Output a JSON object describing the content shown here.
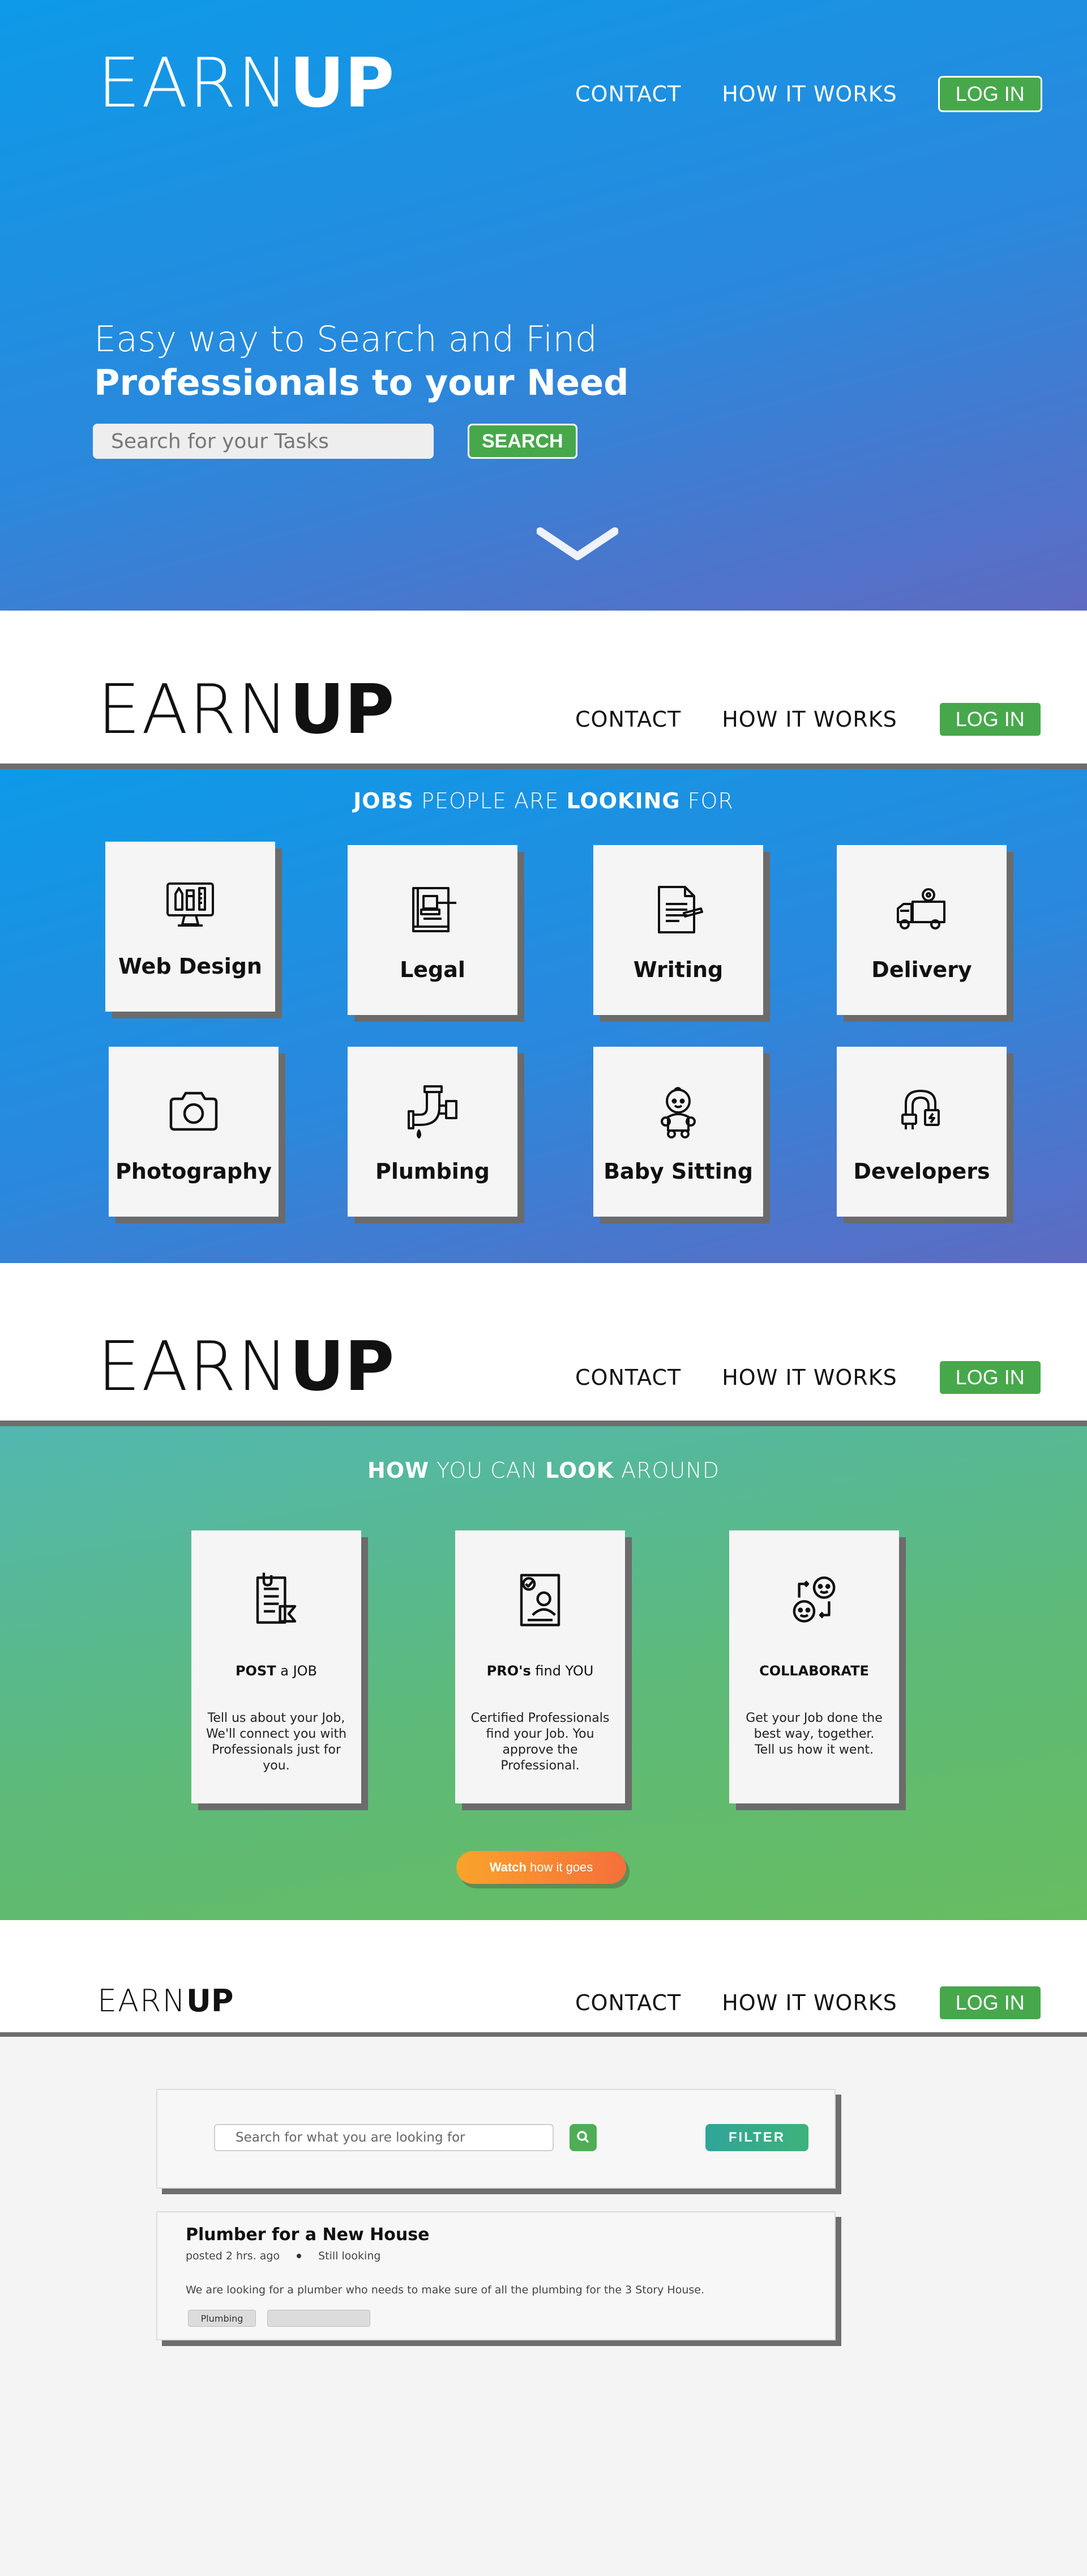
{
  "brand": {
    "light": "EARN",
    "bold": "UP"
  },
  "nav": {
    "contact": "CONTACT",
    "how_it_works": "HOW IT WORKS",
    "login": "LOG IN"
  },
  "hero": {
    "line1": "Easy way to Search and Find",
    "line2": "Professionals to your Need",
    "search_placeholder": "Search for your Tasks",
    "search_button": "SEARCH"
  },
  "jobs": {
    "heading": {
      "b1": "JOBS",
      "t1": " PEOPLE ARE ",
      "b2": "LOOKING",
      "t2": " FOR"
    },
    "items": [
      {
        "label": "Web Design",
        "icon": "monitor-tools-icon"
      },
      {
        "label": "Legal",
        "icon": "law-book-gavel-icon"
      },
      {
        "label": "Writing",
        "icon": "document-pen-icon"
      },
      {
        "label": "Delivery",
        "icon": "delivery-truck-icon"
      },
      {
        "label": "Photography",
        "icon": "camera-icon"
      },
      {
        "label": "Plumbing",
        "icon": "faucet-pipe-icon"
      },
      {
        "label": "Baby Sitting",
        "icon": "baby-icon"
      },
      {
        "label": "Developers",
        "icon": "plug-cable-icon"
      }
    ]
  },
  "how": {
    "heading": {
      "b1": "HOW",
      "t1": " YOU CAN ",
      "b2": "LOOK",
      "t2": " AROUND"
    },
    "steps": [
      {
        "title_bold": "POST",
        "title_rest": " a JOB",
        "desc": "Tell us about your Job, We'll connect you with Professionals just for you.",
        "icon": "post-document-icon"
      },
      {
        "title_bold": "PRO's",
        "title_rest": " find YOU",
        "desc": "Certified Professionals find your Job. You approve the Professional.",
        "icon": "certified-profile-icon"
      },
      {
        "title_bold": "COLLABORATE",
        "title_rest": "",
        "desc": "Get your Job done the best way, together. Tell us how it went.",
        "icon": "collaborate-exchange-icon"
      }
    ],
    "watch_bold": "Watch",
    "watch_rest": " how it goes"
  },
  "listing": {
    "search_placeholder": "Search for what you are looking for",
    "filter_button": "FILTER",
    "job": {
      "title": "Plumber for a New House",
      "posted": "posted 2 hrs. ago",
      "status": "Still looking",
      "description": "We are looking for a plumber who needs to make sure of all the plumbing for the 3 Story House.",
      "tags": [
        "Plumbing",
        ""
      ]
    }
  },
  "colors": {
    "blue_gradient_start": "#0d9ae8",
    "blue_gradient_end": "#5f6ac2",
    "green_gradient_start": "#52b7b0",
    "green_gradient_end": "#67bd60",
    "accent_green": "#47a84b",
    "watch_orange": "#f78a33"
  }
}
